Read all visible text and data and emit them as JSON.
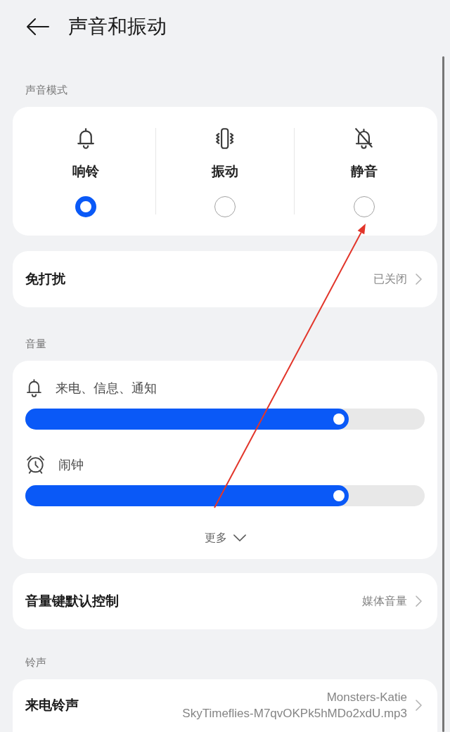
{
  "header": {
    "title": "声音和振动"
  },
  "sound_mode": {
    "label": "声音模式",
    "modes": [
      {
        "kind": "ring",
        "label": "响铃",
        "selected": true
      },
      {
        "kind": "vibrate",
        "label": "振动",
        "selected": false
      },
      {
        "kind": "silent",
        "label": "静音",
        "selected": false
      }
    ]
  },
  "do_not_disturb": {
    "label": "免打扰",
    "value": "已关闭"
  },
  "volume": {
    "label": "音量",
    "sliders": [
      {
        "kind": "ring",
        "label": "来电、信息、通知",
        "level": 0.81
      },
      {
        "kind": "alarm",
        "label": "闹钟",
        "level": 0.81
      }
    ],
    "more": {
      "label": "更多",
      "expanded": false
    }
  },
  "volume_key": {
    "label": "音量键默认控制",
    "value": "媒体音量"
  },
  "ringtones": {
    "label": "铃声",
    "items": [
      {
        "label": "来电铃声",
        "value_lines": [
          "Monsters-Katie",
          "SkyTimeflies-M7qvOKPk5hMDo2xdU.mp3"
        ]
      }
    ]
  },
  "annotation": {
    "kind": "arrow"
  }
}
